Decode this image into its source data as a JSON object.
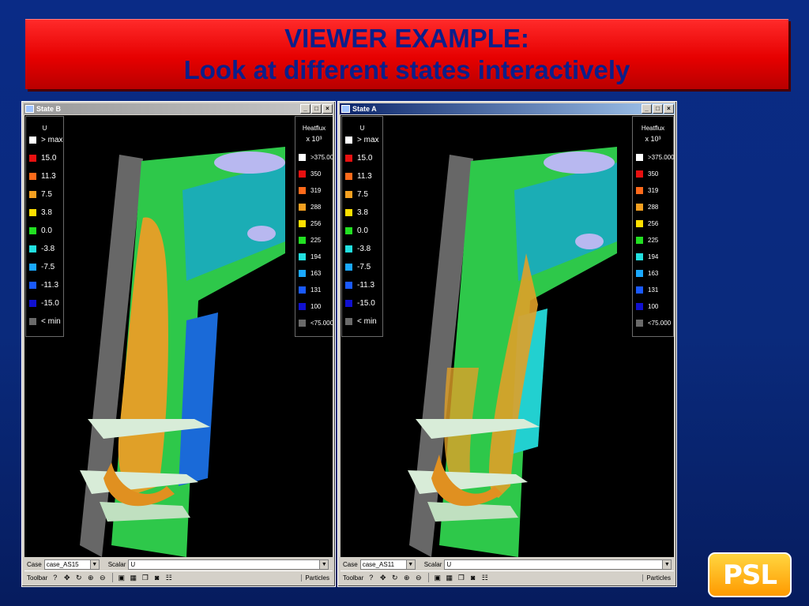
{
  "slide": {
    "title_line1": "VIEWER EXAMPLE:",
    "title_line2": "Look at different states interactively",
    "logo_text": "PSL"
  },
  "windows": [
    {
      "title": "State B",
      "active": false,
      "legend_left": {
        "title": "U",
        "items": [
          {
            "label": "> max",
            "color": "#ffffff"
          },
          {
            "label": "15.0",
            "color": "#e81010"
          },
          {
            "label": "11.3",
            "color": "#ff6a1a"
          },
          {
            "label": "7.5",
            "color": "#f5a020"
          },
          {
            "label": "3.8",
            "color": "#ffe000"
          },
          {
            "label": "0.0",
            "color": "#22e022"
          },
          {
            "label": "-3.8",
            "color": "#22e0e0"
          },
          {
            "label": "-7.5",
            "color": "#1aa8ff"
          },
          {
            "label": "-11.3",
            "color": "#1a5aff"
          },
          {
            "label": "-15.0",
            "color": "#1010d0"
          },
          {
            "label": "< min",
            "color": "#6a6a6a"
          }
        ]
      },
      "legend_right": {
        "title": "Heatflux",
        "subtitle": "x 10³",
        "items": [
          {
            "label": ">375.000",
            "color": "#ffffff"
          },
          {
            "label": "350",
            "color": "#e81010"
          },
          {
            "label": "319",
            "color": "#ff6a1a"
          },
          {
            "label": "288",
            "color": "#f5a020"
          },
          {
            "label": "256",
            "color": "#ffe000"
          },
          {
            "label": "225",
            "color": "#22e022"
          },
          {
            "label": "194",
            "color": "#22e0e0"
          },
          {
            "label": "163",
            "color": "#1aa8ff"
          },
          {
            "label": "131",
            "color": "#1a5aff"
          },
          {
            "label": "100",
            "color": "#1010d0"
          },
          {
            "label": "<75.000",
            "color": "#6a6a6a"
          }
        ]
      },
      "controls": {
        "case_label": "Case",
        "case_value": "case_AS15",
        "scalar_label": "Scalar",
        "scalar_value": "U"
      },
      "toolbar": {
        "label": "Toolbar",
        "help": "?",
        "particles": "Particles"
      }
    },
    {
      "title": "State A",
      "active": true,
      "legend_left": {
        "title": "U",
        "items": [
          {
            "label": "> max",
            "color": "#ffffff"
          },
          {
            "label": "15.0",
            "color": "#e81010"
          },
          {
            "label": "11.3",
            "color": "#ff6a1a"
          },
          {
            "label": "7.5",
            "color": "#f5a020"
          },
          {
            "label": "3.8",
            "color": "#ffe000"
          },
          {
            "label": "0.0",
            "color": "#22e022"
          },
          {
            "label": "-3.8",
            "color": "#22e0e0"
          },
          {
            "label": "-7.5",
            "color": "#1aa8ff"
          },
          {
            "label": "-11.3",
            "color": "#1a5aff"
          },
          {
            "label": "-15.0",
            "color": "#1010d0"
          },
          {
            "label": "< min",
            "color": "#6a6a6a"
          }
        ]
      },
      "legend_right": {
        "title": "Heatflux",
        "subtitle": "x 10³",
        "items": [
          {
            "label": ">375.000",
            "color": "#ffffff"
          },
          {
            "label": "350",
            "color": "#e81010"
          },
          {
            "label": "319",
            "color": "#ff6a1a"
          },
          {
            "label": "288",
            "color": "#f5a020"
          },
          {
            "label": "256",
            "color": "#ffe000"
          },
          {
            "label": "225",
            "color": "#22e022"
          },
          {
            "label": "194",
            "color": "#22e0e0"
          },
          {
            "label": "163",
            "color": "#1aa8ff"
          },
          {
            "label": "131",
            "color": "#1a5aff"
          },
          {
            "label": "100",
            "color": "#1010d0"
          },
          {
            "label": "<75.000",
            "color": "#6a6a6a"
          }
        ]
      },
      "controls": {
        "case_label": "Case",
        "case_value": "case_AS11",
        "scalar_label": "Scalar",
        "scalar_value": "U"
      },
      "toolbar": {
        "label": "Toolbar",
        "help": "?",
        "particles": "Particles"
      }
    }
  ]
}
